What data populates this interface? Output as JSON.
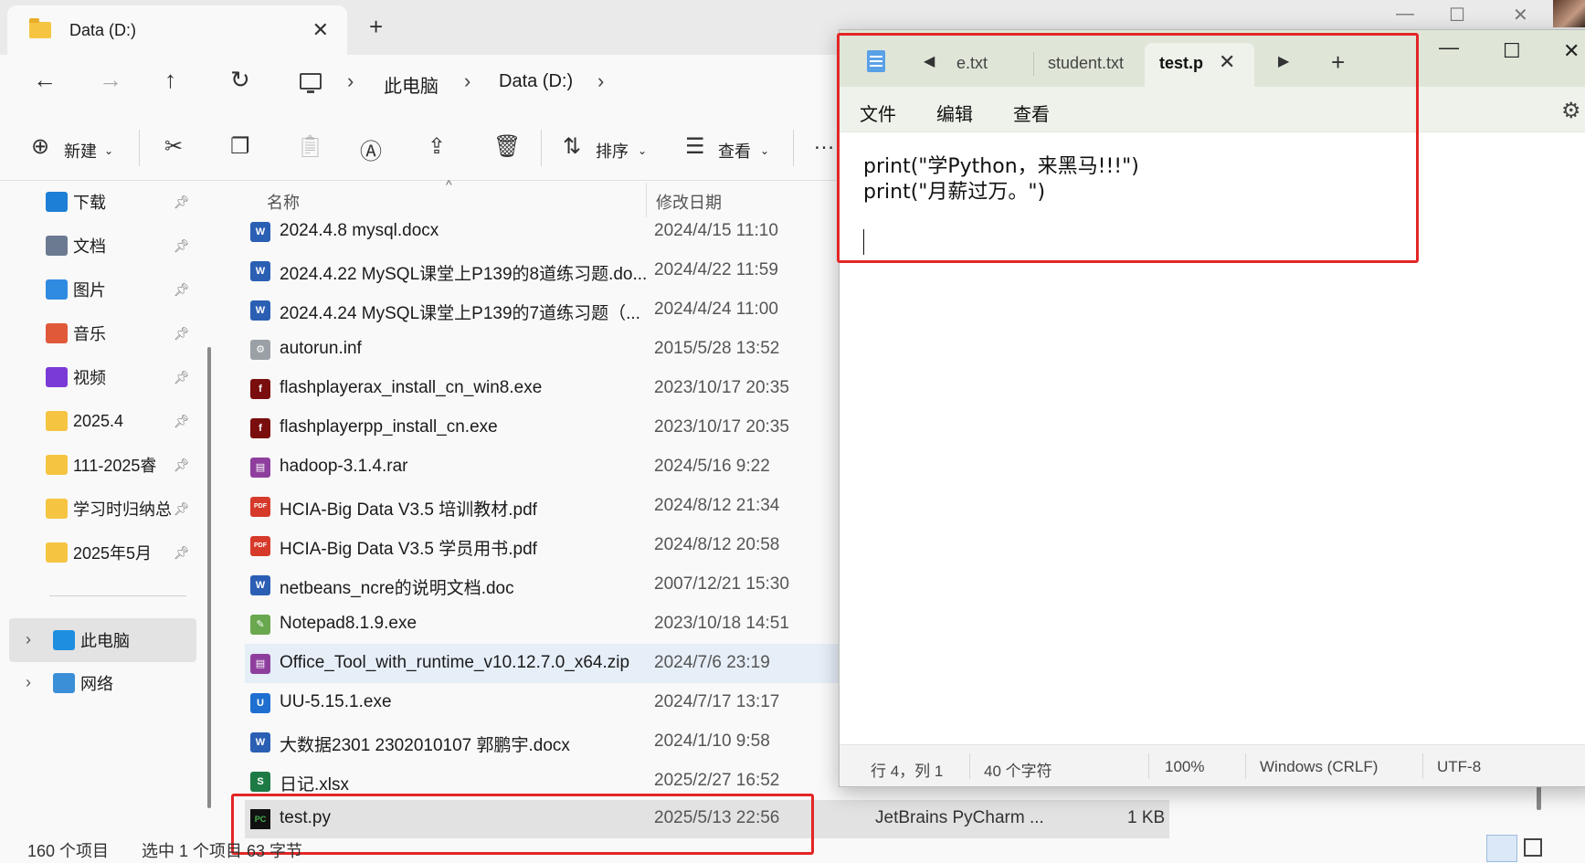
{
  "explorer": {
    "tab_title": "Data (D:)",
    "tab_close": "✕",
    "new_tab": "+",
    "window_controls": {
      "minimize": "—",
      "maximize": "☐",
      "close": "✕"
    },
    "breadcrumb": [
      "此电脑",
      "Data (D:)"
    ],
    "toolbar": {
      "new_label": "新建",
      "sort_label": "排序",
      "view_label": "查看",
      "more_label": "…"
    },
    "sidebar": {
      "items": [
        {
          "label": "下载",
          "icon": "download-icon",
          "color": "#1e7fd6"
        },
        {
          "label": "文档",
          "icon": "document-icon",
          "color": "#6b7a90"
        },
        {
          "label": "图片",
          "icon": "picture-icon",
          "color": "#2e8be0"
        },
        {
          "label": "音乐",
          "icon": "music-icon",
          "color": "#e05a3a"
        },
        {
          "label": "视频",
          "icon": "video-icon",
          "color": "#7a3ad6"
        },
        {
          "label": "2025.4",
          "icon": "folder-icon",
          "color": "#f5c542"
        },
        {
          "label": "111-2025睿",
          "icon": "folder-icon",
          "color": "#f5c542"
        },
        {
          "label": "学习时归纳总",
          "icon": "folder-icon",
          "color": "#f5c542"
        },
        {
          "label": "2025年5月",
          "icon": "folder-icon",
          "color": "#f5c542"
        }
      ],
      "this_pc": "此电脑",
      "network": "网络"
    },
    "columns": {
      "name": "名称",
      "date": "修改日期"
    },
    "files": [
      {
        "name": "2024.4.8 mysql.docx",
        "date": "2024/4/15 11:10",
        "icon": "word-icon",
        "color": "#2b5fb4",
        "glyph": "W"
      },
      {
        "name": "2024.4.22 MySQL课堂上P139的8道练习题.do...",
        "date": "2024/4/22 11:59",
        "icon": "word-icon",
        "color": "#2b5fb4",
        "glyph": "W"
      },
      {
        "name": "2024.4.24 MySQL课堂上P139的7道练习题（...",
        "date": "2024/4/24 11:00",
        "icon": "word-icon",
        "color": "#2b5fb4",
        "glyph": "W"
      },
      {
        "name": "autorun.inf",
        "date": "2015/5/28 13:52",
        "icon": "settings-file-icon",
        "color": "#9aa0a6",
        "glyph": "⚙"
      },
      {
        "name": "flashplayerax_install_cn_win8.exe",
        "date": "2023/10/17 20:35",
        "icon": "flash-icon",
        "color": "#7a0e0e",
        "glyph": "f"
      },
      {
        "name": "flashplayerpp_install_cn.exe",
        "date": "2023/10/17 20:35",
        "icon": "flash-icon",
        "color": "#7a0e0e",
        "glyph": "f"
      },
      {
        "name": "hadoop-3.1.4.rar",
        "date": "2024/5/16 9:22",
        "icon": "archive-icon",
        "color": "#8e3f9e",
        "glyph": "▤"
      },
      {
        "name": "HCIA-Big Data V3.5 培训教材.pdf",
        "date": "2024/8/12 21:34",
        "icon": "pdf-icon",
        "color": "#d63a2a",
        "glyph": "PDF"
      },
      {
        "name": "HCIA-Big Data V3.5 学员用书.pdf",
        "date": "2024/8/12 20:58",
        "icon": "pdf-icon",
        "color": "#d63a2a",
        "glyph": "PDF"
      },
      {
        "name": "netbeans_ncre的说明文档.doc",
        "date": "2007/12/21 15:30",
        "icon": "word-icon",
        "color": "#2b5fb4",
        "glyph": "W"
      },
      {
        "name": "Notepad8.1.9.exe",
        "date": "2023/10/18 14:51",
        "icon": "notepad-plus-icon",
        "color": "#6aa84f",
        "glyph": "✎"
      },
      {
        "name": "Office_Tool_with_runtime_v10.12.7.0_x64.zip",
        "date": "2024/7/6 23:19",
        "icon": "archive-icon",
        "color": "#8e3f9e",
        "glyph": "▤"
      },
      {
        "name": "UU-5.15.1.exe",
        "date": "2024/7/17 13:17",
        "icon": "uu-icon",
        "color": "#1f6fd0",
        "glyph": "U"
      },
      {
        "name": "大数据2301  2302010107   郭鹏宇.docx",
        "date": "2024/1/10 9:58",
        "icon": "word-icon",
        "color": "#2b5fb4",
        "glyph": "W"
      },
      {
        "name": "日记.xlsx",
        "date": "2025/2/27 16:52",
        "icon": "excel-icon",
        "color": "#1d7a45",
        "glyph": "S"
      }
    ],
    "selected_file": {
      "name": "test.py",
      "date": "2025/5/13 22:56",
      "type": "JetBrains PyCharm ...",
      "size": "1 KB",
      "icon_glyph": "PC"
    },
    "status": {
      "count": "160 个项目",
      "selection": "选中 1 个项目  63 字节"
    }
  },
  "notepad": {
    "tabs": [
      "e.txt",
      "student.txt"
    ],
    "active_tab": "test.p",
    "tab_close": "✕",
    "new_tab": "+",
    "window_controls": {
      "minimize": "—",
      "maximize": "☐",
      "close": "✕"
    },
    "menu": [
      "文件",
      "编辑",
      "查看"
    ],
    "content": "print(\"学Python，来黑马!!!\")\nprint(\"月薪过万。\")",
    "status": {
      "position": "行 4，列 1",
      "chars": "40 个字符",
      "zoom": "100%",
      "line_ending": "Windows (CRLF)",
      "encoding": "UTF-8"
    }
  },
  "colors": {
    "highlight": "#e32626",
    "selection": "#e2e2e2",
    "hover_row": "#e6eef8"
  }
}
